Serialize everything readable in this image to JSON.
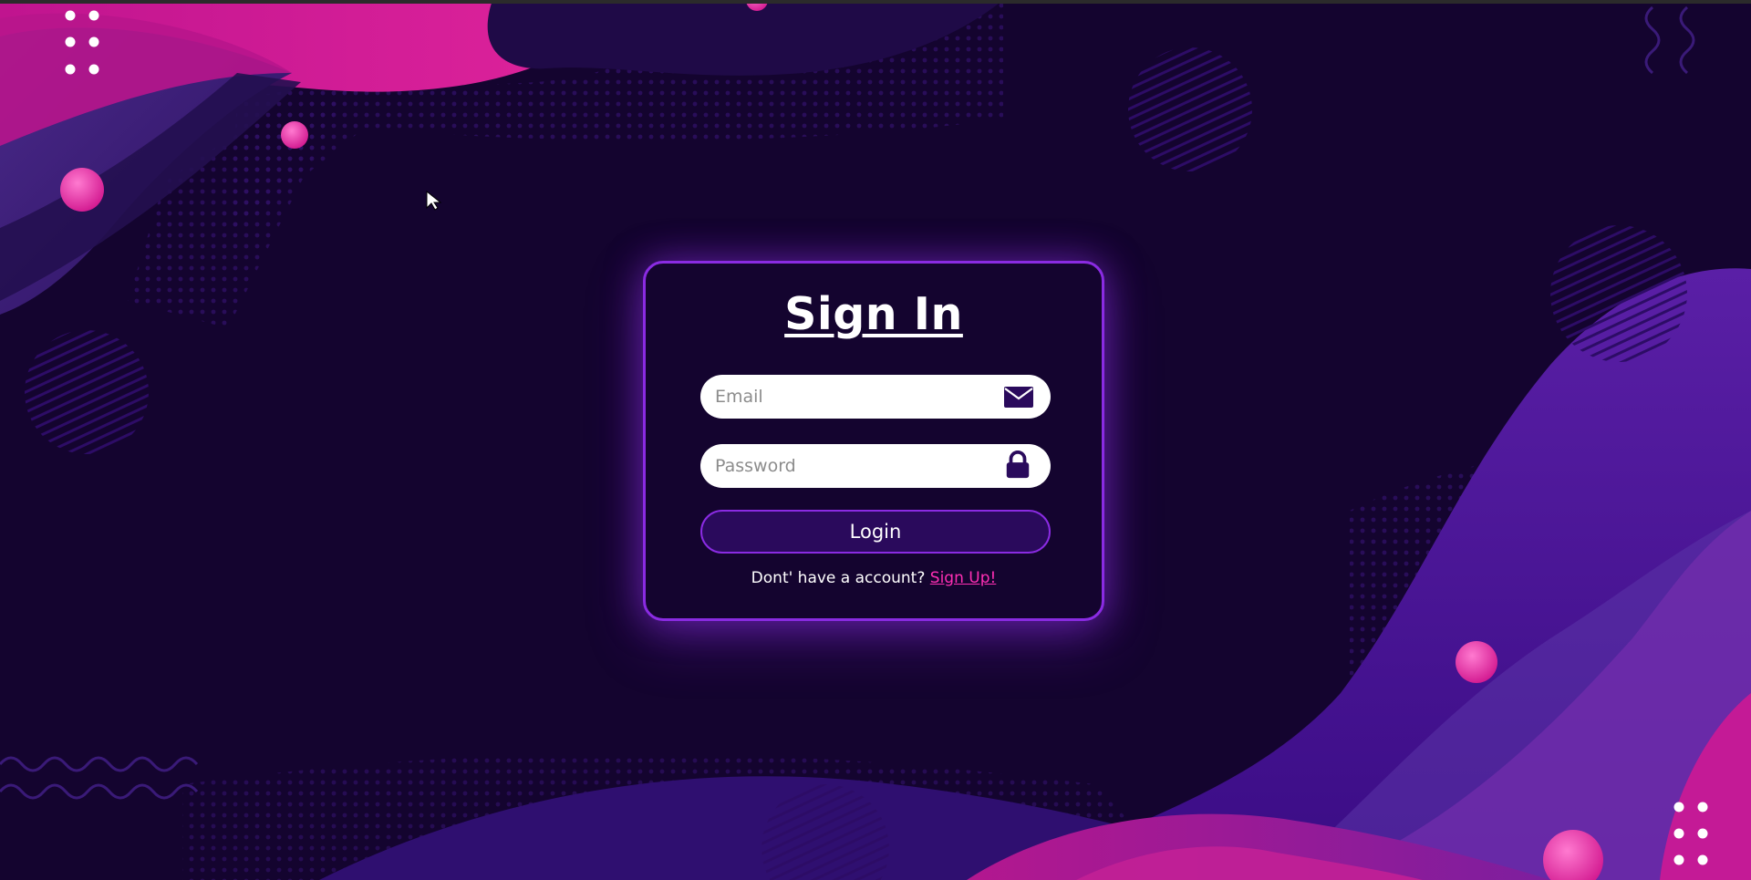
{
  "card": {
    "title": "Sign In",
    "email": {
      "placeholder": "Email",
      "value": ""
    },
    "password": {
      "placeholder": "Password",
      "value": ""
    },
    "login_label": "Login",
    "signup_prompt": "Dont' have a account?",
    "signup_link": "Sign Up!"
  },
  "icons": {
    "email": "envelope-icon",
    "password": "lock-icon"
  },
  "colors": {
    "background": "#14042f",
    "accent": "#8a2be2",
    "link": "#ff2fb4",
    "button_fill": "#2a0a5c",
    "pink": "#e0249c"
  }
}
